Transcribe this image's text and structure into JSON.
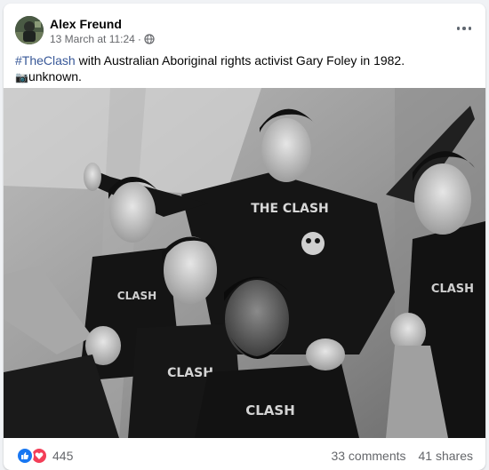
{
  "post": {
    "author": "Alex Freund",
    "timestamp": "13 March at 11:24",
    "separator": "·",
    "privacy_icon": "globe-icon",
    "more_icon": "more-options-icon",
    "text": {
      "hashtag": "#TheClash",
      "line1_rest": " with Australian Aboriginal rights activist Gary Foley in 1982.",
      "camera_glyph": "📷",
      "line2_rest": "unknown."
    },
    "photo": {
      "caption_shirt_text": "THE CLASH",
      "kind": "black-and-white group photograph"
    },
    "engagement": {
      "reaction_icons": [
        "like-icon",
        "love-icon"
      ],
      "reaction_count": "445",
      "comments": "33 comments",
      "shares": "41 shares"
    }
  },
  "colors": {
    "link": "#385898",
    "secondary_text": "#65676b",
    "like": "#1877f2",
    "love": "#f33e58"
  }
}
